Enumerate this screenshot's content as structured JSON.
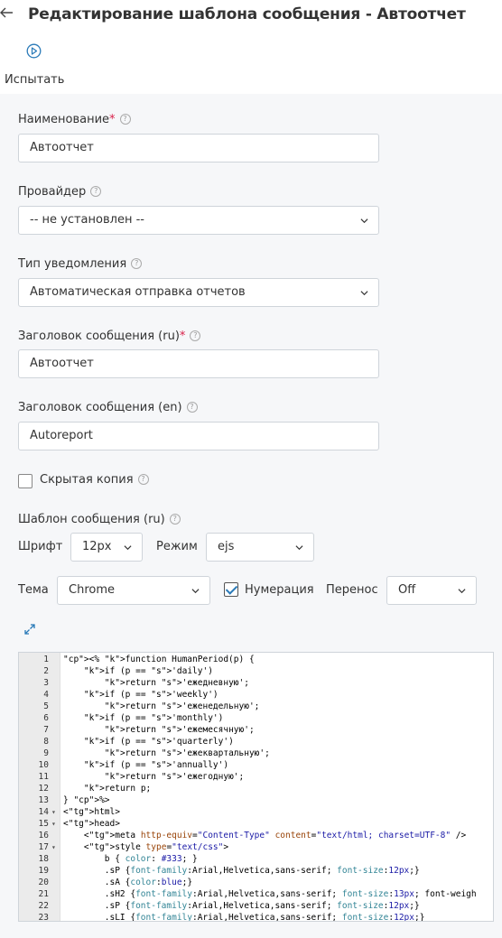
{
  "header": {
    "back_icon": "arrow-left-icon",
    "title": "Редактирование шаблона сообщения - Автоотчет"
  },
  "toolbar": {
    "test_label": "Испытать",
    "test_icon": "play-circle-icon"
  },
  "form": {
    "name_label": "Наименование",
    "name_value": "Автоотчет",
    "provider_label": "Провайдер",
    "provider_value": "-- не установлен --",
    "type_label": "Тип уведомления",
    "type_value": "Автоматическая отправка отчетов",
    "subject_ru_label": "Заголовок сообщения (ru)",
    "subject_ru_value": "Автоотчет",
    "subject_en_label": "Заголовок сообщения (en)",
    "subject_en_value": "Autoreport",
    "bcc_label": "Скрытая копия",
    "bcc_checked": false,
    "template_label": "Шаблон сообщения (ru)",
    "required_mark": "*",
    "help_mark": "?"
  },
  "editor_settings": {
    "font_label": "Шрифт",
    "font_value": "12px",
    "mode_label": "Режим",
    "mode_value": "ejs",
    "theme_label": "Тема",
    "theme_value": "Chrome",
    "numbering_label": "Нумерация",
    "numbering_checked": true,
    "wrap_label": "Перенос",
    "wrap_value": "Off"
  },
  "code_lines": [
    {
      "n": "1",
      "fold": "",
      "text": "<% function HumanPeriod(p) {"
    },
    {
      "n": "2",
      "fold": "",
      "text": "    if (p == 'daily')"
    },
    {
      "n": "3",
      "fold": "",
      "text": "        return 'ежедневную';"
    },
    {
      "n": "4",
      "fold": "",
      "text": "    if (p == 'weekly')"
    },
    {
      "n": "5",
      "fold": "",
      "text": "        return 'еженедельную';"
    },
    {
      "n": "6",
      "fold": "",
      "text": "    if (p == 'monthly')"
    },
    {
      "n": "7",
      "fold": "",
      "text": "        return 'ежемесячную';"
    },
    {
      "n": "8",
      "fold": "",
      "text": "    if (p == 'quarterly')"
    },
    {
      "n": "9",
      "fold": "",
      "text": "        return 'ежеквартальную';"
    },
    {
      "n": "10",
      "fold": "",
      "text": "    if (p == 'annually')"
    },
    {
      "n": "11",
      "fold": "",
      "text": "        return 'ежегодную';"
    },
    {
      "n": "12",
      "fold": "",
      "text": "    return p;"
    },
    {
      "n": "13",
      "fold": "",
      "text": "} %>"
    },
    {
      "n": "14",
      "fold": "▾",
      "text": "<html>"
    },
    {
      "n": "15",
      "fold": "▾",
      "text": "<head>"
    },
    {
      "n": "16",
      "fold": "",
      "text": "    <meta http-equiv=\"Content-Type\" content=\"text/html; charset=UTF-8\" />"
    },
    {
      "n": "17",
      "fold": "▾",
      "text": "    <style type=\"text/css\">"
    },
    {
      "n": "18",
      "fold": "",
      "text": "        b { color: #333; }"
    },
    {
      "n": "19",
      "fold": "",
      "text": "        .sP {font-family:Arial,Helvetica,sans-serif; font-size:12px;}"
    },
    {
      "n": "20",
      "fold": "",
      "text": "        .sA {color:blue;}"
    },
    {
      "n": "21",
      "fold": "",
      "text": "        .sH2 {font-family:Arial,Helvetica,sans-serif; font-size:13px; font-weigh"
    },
    {
      "n": "22",
      "fold": "",
      "text": "        .sP {font-family:Arial,Helvetica,sans-serif; font-size:12px;}"
    },
    {
      "n": "23",
      "fold": "",
      "text": "        .sLI {font-family:Arial,Helvetica,sans-serif; font-size:12px;}"
    }
  ],
  "colors": {
    "accent": "#2a7ab8",
    "required": "#d9214a",
    "panel_bg": "#f6f7f9"
  }
}
